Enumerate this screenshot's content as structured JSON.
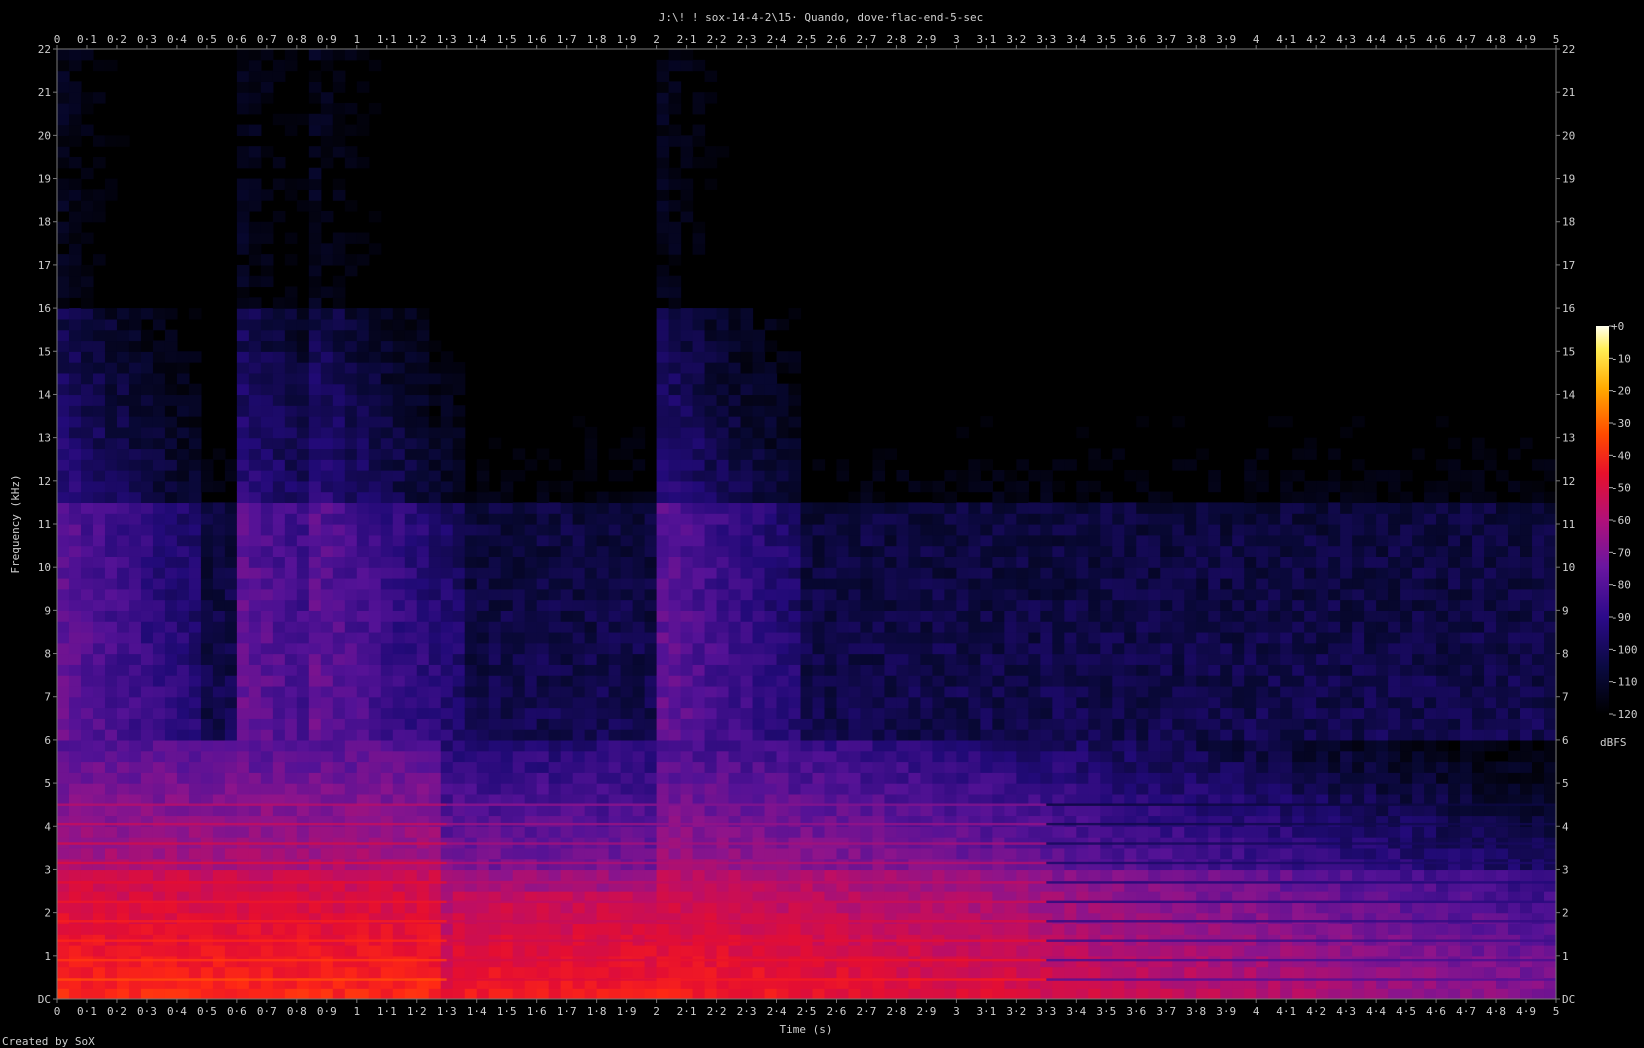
{
  "chart_data": {
    "type": "heatmap",
    "title": "J:\\! ! sox-14-4-2\\15· Quando, dove·flac-end-5-sec",
    "xlabel": "Time (s)",
    "ylabel": "Frequency (kHz)",
    "xlim": [
      0,
      5
    ],
    "ylim": [
      0,
      22
    ],
    "x_ticks": [
      "0",
      "0·1",
      "0·2",
      "0·3",
      "0·4",
      "0·5",
      "0·6",
      "0·7",
      "0·8",
      "0·9",
      "1",
      "1·1",
      "1·2",
      "1·3",
      "1·4",
      "1·5",
      "1·6",
      "1·7",
      "1·8",
      "1·9",
      "2",
      "2·1",
      "2·2",
      "2·3",
      "2·4",
      "2·5",
      "2·6",
      "2·7",
      "2·8",
      "2·9",
      "3",
      "3·1",
      "3·2",
      "3·3",
      "3·4",
      "3·5",
      "3·6",
      "3·7",
      "3·8",
      "3·9",
      "4",
      "4·1",
      "4·2",
      "4·3",
      "4·4",
      "4·5",
      "4·6",
      "4·7",
      "4·8",
      "4·9",
      "5"
    ],
    "y_ticks": [
      "DC",
      "1",
      "2",
      "3",
      "4",
      "5",
      "6",
      "7",
      "8",
      "9",
      "10",
      "11",
      "12",
      "13",
      "14",
      "15",
      "16",
      "17",
      "18",
      "19",
      "20",
      "21",
      "22"
    ],
    "colorbar": {
      "label": "dBFS",
      "ticks": [
        "+0",
        "-10",
        "-20",
        "-30",
        "-40",
        "-50",
        "-60",
        "-70",
        "-80",
        "-90",
        "-100",
        "-110",
        "-120"
      ],
      "range": [
        -120,
        0
      ]
    },
    "footer": "Created by SoX",
    "grid": false,
    "features": {
      "noise_floor_db": -120,
      "lowpass_edge_khz": 6,
      "strong_band_khz": [
        0,
        3
      ],
      "peak_level_db": -35,
      "onsets_s": [
        0,
        0.62,
        0.85,
        2.0
      ],
      "fade_out_s": [
        3.0,
        5.0
      ]
    }
  }
}
